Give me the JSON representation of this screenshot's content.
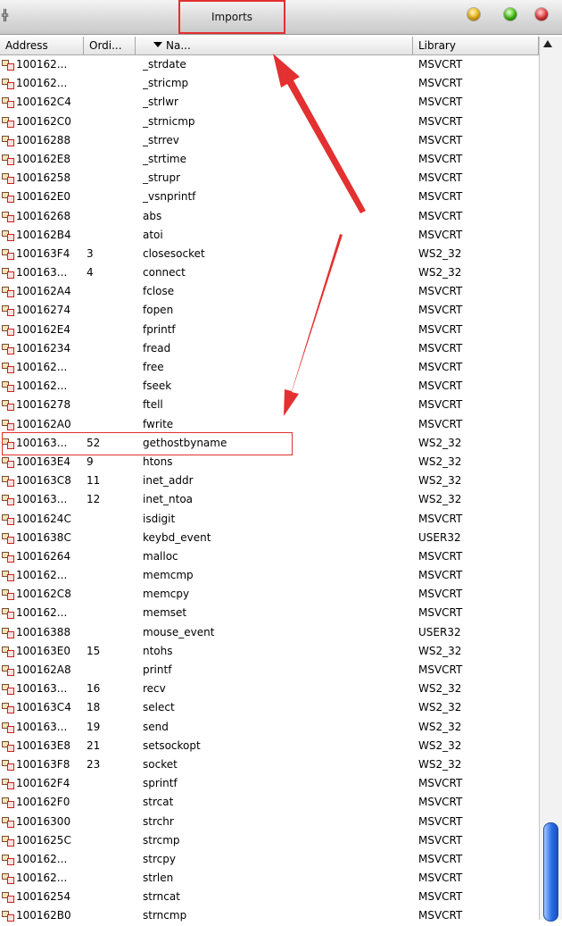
{
  "window": {
    "title": "Imports"
  },
  "columns": {
    "address": "Address",
    "ordinal": "Ordi...",
    "name": "Na...",
    "library": "Library"
  },
  "colors": {
    "annotation": "#e33030",
    "thumb": "#2a6ee6"
  },
  "rows": [
    {
      "address": "100162...",
      "ordinal": "",
      "name": "_strdate",
      "library": "MSVCRT"
    },
    {
      "address": "100162...",
      "ordinal": "",
      "name": "_stricmp",
      "library": "MSVCRT"
    },
    {
      "address": "100162C4",
      "ordinal": "",
      "name": "_strlwr",
      "library": "MSVCRT"
    },
    {
      "address": "100162C0",
      "ordinal": "",
      "name": "_strnicmp",
      "library": "MSVCRT"
    },
    {
      "address": "10016288",
      "ordinal": "",
      "name": "_strrev",
      "library": "MSVCRT"
    },
    {
      "address": "100162E8",
      "ordinal": "",
      "name": "_strtime",
      "library": "MSVCRT"
    },
    {
      "address": "10016258",
      "ordinal": "",
      "name": "_strupr",
      "library": "MSVCRT"
    },
    {
      "address": "100162E0",
      "ordinal": "",
      "name": "_vsnprintf",
      "library": "MSVCRT"
    },
    {
      "address": "10016268",
      "ordinal": "",
      "name": "abs",
      "library": "MSVCRT"
    },
    {
      "address": "100162B4",
      "ordinal": "",
      "name": "atoi",
      "library": "MSVCRT"
    },
    {
      "address": "100163F4",
      "ordinal": "3",
      "name": "closesocket",
      "library": "WS2_32"
    },
    {
      "address": "100163...",
      "ordinal": "4",
      "name": "connect",
      "library": "WS2_32"
    },
    {
      "address": "100162A4",
      "ordinal": "",
      "name": "fclose",
      "library": "MSVCRT"
    },
    {
      "address": "10016274",
      "ordinal": "",
      "name": "fopen",
      "library": "MSVCRT"
    },
    {
      "address": "100162E4",
      "ordinal": "",
      "name": "fprintf",
      "library": "MSVCRT"
    },
    {
      "address": "10016234",
      "ordinal": "",
      "name": "fread",
      "library": "MSVCRT"
    },
    {
      "address": "100162...",
      "ordinal": "",
      "name": "free",
      "library": "MSVCRT"
    },
    {
      "address": "100162...",
      "ordinal": "",
      "name": "fseek",
      "library": "MSVCRT"
    },
    {
      "address": "10016278",
      "ordinal": "",
      "name": "ftell",
      "library": "MSVCRT"
    },
    {
      "address": "100162A0",
      "ordinal": "",
      "name": "fwrite",
      "library": "MSVCRT"
    },
    {
      "address": "100163...",
      "ordinal": "52",
      "name": "gethostbyname",
      "library": "WS2_32"
    },
    {
      "address": "100163E4",
      "ordinal": "9",
      "name": "htons",
      "library": "WS2_32"
    },
    {
      "address": "100163C8",
      "ordinal": "11",
      "name": "inet_addr",
      "library": "WS2_32"
    },
    {
      "address": "100163...",
      "ordinal": "12",
      "name": "inet_ntoa",
      "library": "WS2_32"
    },
    {
      "address": "1001624C",
      "ordinal": "",
      "name": "isdigit",
      "library": "MSVCRT"
    },
    {
      "address": "1001638C",
      "ordinal": "",
      "name": "keybd_event",
      "library": "USER32"
    },
    {
      "address": "10016264",
      "ordinal": "",
      "name": "malloc",
      "library": "MSVCRT"
    },
    {
      "address": "100162...",
      "ordinal": "",
      "name": "memcmp",
      "library": "MSVCRT"
    },
    {
      "address": "100162C8",
      "ordinal": "",
      "name": "memcpy",
      "library": "MSVCRT"
    },
    {
      "address": "100162...",
      "ordinal": "",
      "name": "memset",
      "library": "MSVCRT"
    },
    {
      "address": "10016388",
      "ordinal": "",
      "name": "mouse_event",
      "library": "USER32"
    },
    {
      "address": "100163E0",
      "ordinal": "15",
      "name": "ntohs",
      "library": "WS2_32"
    },
    {
      "address": "100162A8",
      "ordinal": "",
      "name": "printf",
      "library": "MSVCRT"
    },
    {
      "address": "100163...",
      "ordinal": "16",
      "name": "recv",
      "library": "WS2_32"
    },
    {
      "address": "100163C4",
      "ordinal": "18",
      "name": "select",
      "library": "WS2_32"
    },
    {
      "address": "100163...",
      "ordinal": "19",
      "name": "send",
      "library": "WS2_32"
    },
    {
      "address": "100163E8",
      "ordinal": "21",
      "name": "setsockopt",
      "library": "WS2_32"
    },
    {
      "address": "100163F8",
      "ordinal": "23",
      "name": "socket",
      "library": "WS2_32"
    },
    {
      "address": "100162F4",
      "ordinal": "",
      "name": "sprintf",
      "library": "MSVCRT"
    },
    {
      "address": "100162F0",
      "ordinal": "",
      "name": "strcat",
      "library": "MSVCRT"
    },
    {
      "address": "10016300",
      "ordinal": "",
      "name": "strchr",
      "library": "MSVCRT"
    },
    {
      "address": "1001625C",
      "ordinal": "",
      "name": "strcmp",
      "library": "MSVCRT"
    },
    {
      "address": "100162...",
      "ordinal": "",
      "name": "strcpy",
      "library": "MSVCRT"
    },
    {
      "address": "100162...",
      "ordinal": "",
      "name": "strlen",
      "library": "MSVCRT"
    },
    {
      "address": "10016254",
      "ordinal": "",
      "name": "strncat",
      "library": "MSVCRT"
    },
    {
      "address": "100162B0",
      "ordinal": "",
      "name": "strncmp",
      "library": "MSVCRT"
    }
  ]
}
